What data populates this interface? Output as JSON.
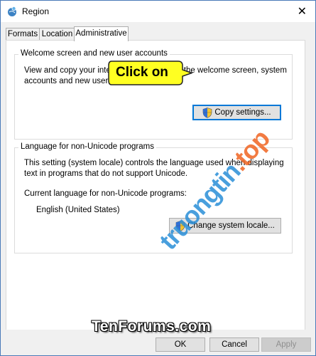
{
  "window": {
    "title": "Region",
    "close_glyph": "✕"
  },
  "tabs": [
    {
      "label": "Formats"
    },
    {
      "label": "Location"
    },
    {
      "label": "Administrative",
      "active": true
    }
  ],
  "welcome_group": {
    "legend": "Welcome screen and new user accounts",
    "line1": "View and copy your international settings to the welcome screen, system",
    "line2": "accounts and new user accounts.",
    "button_label": "Copy settings..."
  },
  "callout": {
    "text": "Click on",
    "color": "#ffff22"
  },
  "unicode_group": {
    "legend": "Language for non-Unicode programs",
    "line1": "This setting (system locale) controls the language used when displaying",
    "line2": "text in programs that do not support Unicode.",
    "current_label": "Current language for non-Unicode programs:",
    "current_value": "English (United States)",
    "button_label": "Change system locale..."
  },
  "dialog_buttons": {
    "ok": "OK",
    "cancel": "Cancel",
    "apply": "Apply"
  },
  "watermarks": {
    "left": "TenForums.com",
    "diagonal_main": "truongtin",
    "diagonal_accent": ".top"
  }
}
